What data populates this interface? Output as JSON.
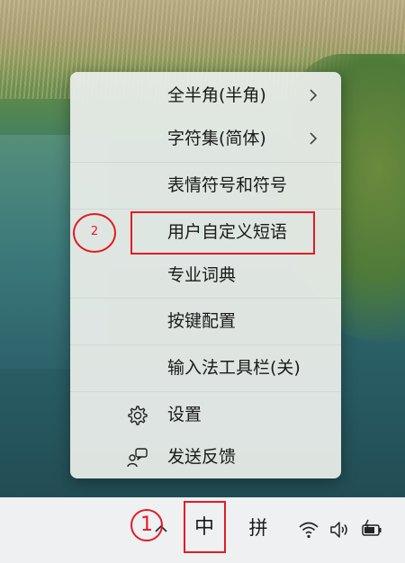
{
  "context_menu": {
    "items": [
      {
        "label": "全半角(半角)",
        "has_submenu": true
      },
      {
        "label": "字符集(简体)",
        "has_submenu": true
      },
      {
        "label": "表情符号和符号"
      },
      {
        "label": "用户自定义短语"
      },
      {
        "label": "专业词典"
      },
      {
        "label": "按键配置"
      },
      {
        "label": "输入法工具栏(关)"
      },
      {
        "label": "设置",
        "icon": "gear-icon"
      },
      {
        "label": "发送反馈",
        "icon": "feedback-icon"
      }
    ]
  },
  "taskbar": {
    "ime_mode": "中",
    "ime_method": "拼",
    "tray_icons": [
      "chevron-up-icon",
      "wifi-icon",
      "volume-icon",
      "battery-icon"
    ]
  },
  "annotations": {
    "step1": "1",
    "step2": "2",
    "color": "#e21c23"
  }
}
